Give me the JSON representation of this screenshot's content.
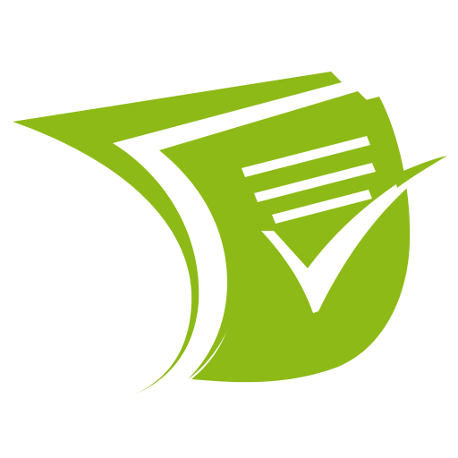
{
  "logo": {
    "icon": "document-checkmark-icon",
    "color_primary": "#8DBA16",
    "color_background": "#FFFFFF"
  }
}
